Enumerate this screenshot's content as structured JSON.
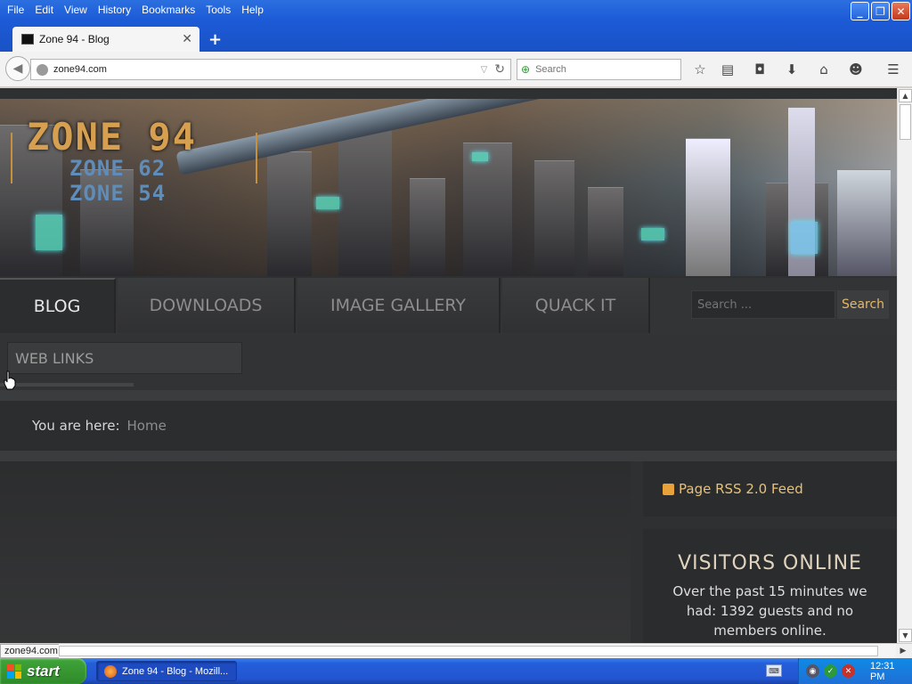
{
  "browser": {
    "menu": [
      "File",
      "Edit",
      "View",
      "History",
      "Bookmarks",
      "Tools",
      "Help"
    ],
    "tab_title": "Zone 94 - Blog",
    "url": "zone94.com",
    "search_placeholder": "Search",
    "status_url": "zone94.com"
  },
  "site": {
    "logo_main": "ZONE 94",
    "logo_sub1": "ZONE 62",
    "logo_sub2": "ZONE 54",
    "nav": [
      "BLOG",
      "DOWNLOADS",
      "IMAGE GALLERY",
      "QUACK IT"
    ],
    "active_nav": "BLOG",
    "search_placeholder": "Search ...",
    "search_button": "Search",
    "subnav": [
      "WEB LINKS"
    ],
    "breadcrumb_label": "You are here:",
    "breadcrumb_home": "Home",
    "rss_label": "Page RSS 2.0 Feed",
    "visitors_title": "VISITORS ONLINE",
    "visitors_text": "Over the past 15 minutes we had: 1392 guests and no members online."
  },
  "taskbar": {
    "start": "start",
    "task_item": "Zone 94 - Blog - Mozill...",
    "clock": "12:31 PM"
  },
  "colors": {
    "accent_gold": "#e5b86a",
    "page_bg": "#2f3031",
    "xp_blue": "#245edb",
    "start_green": "#3fa43a"
  }
}
